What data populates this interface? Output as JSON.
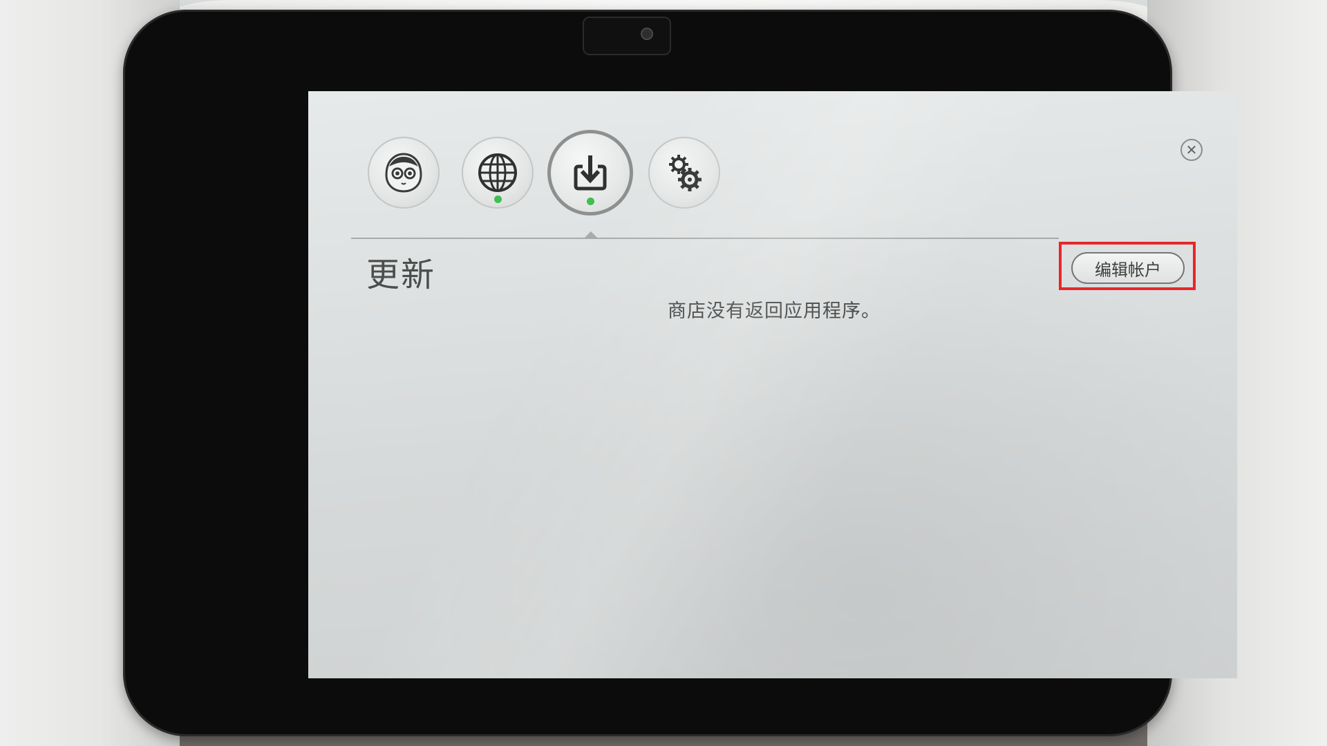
{
  "tabs": [
    {
      "name": "robot",
      "icon": "robot-face-icon",
      "status_dot": false
    },
    {
      "name": "web",
      "icon": "globe-icon",
      "status_dot": true
    },
    {
      "name": "update",
      "icon": "download-icon",
      "status_dot": true,
      "selected": true
    },
    {
      "name": "settings",
      "icon": "gears-icon",
      "status_dot": false
    }
  ],
  "page": {
    "title": "更新",
    "message": "商店没有返回应用程序。"
  },
  "buttons": {
    "edit_account": "编辑帐户",
    "close": "✕"
  },
  "colors": {
    "status_dot": "#3fbf4f",
    "highlight": "#e8262a",
    "screen_bg": "#dde0e0"
  }
}
